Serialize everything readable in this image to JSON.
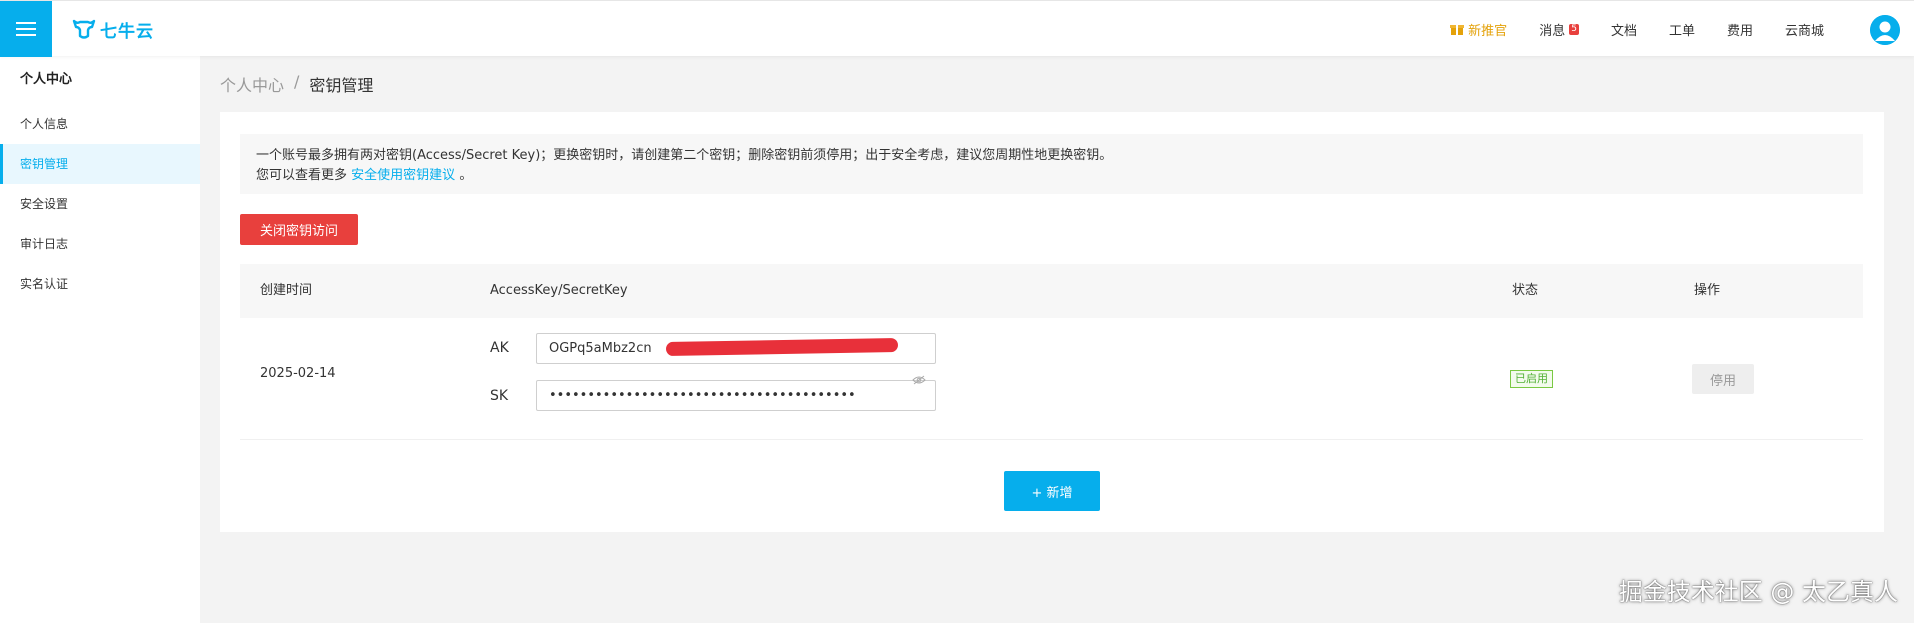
{
  "header": {
    "logo_text": "七牛云",
    "nav": [
      {
        "label": "新推官",
        "icon": "gift-icon",
        "highlight": true
      },
      {
        "label": "消息",
        "badge": "5"
      },
      {
        "label": "文档"
      },
      {
        "label": "工单"
      },
      {
        "label": "费用"
      },
      {
        "label": "云商城"
      }
    ]
  },
  "sidebar": {
    "title": "个人中心",
    "items": [
      {
        "label": "个人信息",
        "active": false
      },
      {
        "label": "密钥管理",
        "active": true
      },
      {
        "label": "安全设置",
        "active": false
      },
      {
        "label": "审计日志",
        "active": false
      },
      {
        "label": "实名认证",
        "active": false
      }
    ]
  },
  "breadcrumb": {
    "root": "个人中心",
    "separator": "/",
    "current": "密钥管理"
  },
  "notice": {
    "line1": "一个账号最多拥有两对密钥(Access/Secret Key)；更换密钥时，请创建第二个密钥；删除密钥前须停用；出于安全考虑，建议您周期性地更换密钥。",
    "line2_prefix": "您可以查看更多",
    "line2_link": "安全使用密钥建议",
    "line2_suffix": "。"
  },
  "actions": {
    "close_access": "关闭密钥访问",
    "add": "+ 新增"
  },
  "table": {
    "headers": [
      "创建时间",
      "AccessKey/SecretKey",
      "状态",
      "操作"
    ],
    "rows": [
      {
        "created": "2025-02-14",
        "ak_label": "AK",
        "ak_value": "OGPq5aMbz2cn",
        "sk_label": "SK",
        "sk_value": "••••••••••••••••••••••••••••••••••••••••",
        "status": "已启用",
        "op": "停用"
      }
    ]
  },
  "watermark": "掘金技术社区 @ 太乙真人",
  "colors": {
    "brand": "#06aeec",
    "danger": "#e8403d",
    "success": "#52b035",
    "promo": "#e4a20a"
  }
}
